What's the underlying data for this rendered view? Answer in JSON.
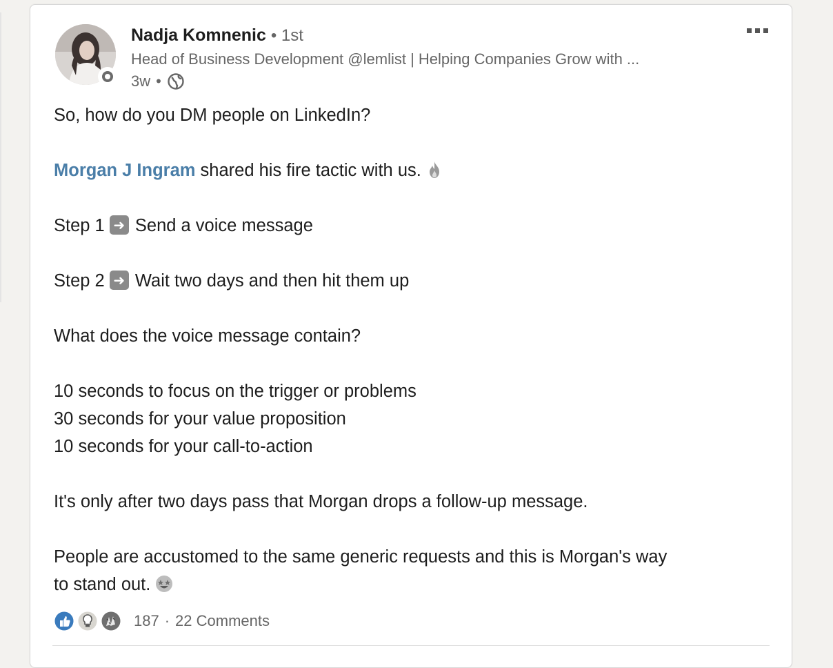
{
  "post": {
    "author": {
      "name": "Nadja Komnenic",
      "degree": "• 1st",
      "headline": "Head of Business Development @lemlist | Helping Companies Grow with ...",
      "time": "3w",
      "meta_sep": "•",
      "visibility_icon": "globe-icon"
    },
    "more_icon": "more-horizontal-icon",
    "body": {
      "line1": "So, how do you DM people on LinkedIn?",
      "mention": "Morgan J Ingram",
      "line2_rest": " shared his fire tactic with us. ",
      "step1_prefix": "Step 1 ",
      "step1_text": " Send a voice message",
      "step2_prefix": "Step 2 ",
      "step2_text": " Wait two days and then hit them up",
      "question": "What does the voice message contain?",
      "item1": "10 seconds to focus on the trigger or problems",
      "item2": "30 seconds for your value proposition",
      "item3": "10 seconds for your call-to-action",
      "followup": "It's only after two days pass that Morgan drops a follow-up message.",
      "closing_1": "People are accustomed to the same generic requests and this is Morgan's way",
      "closing_2": "to stand out. "
    },
    "social": {
      "reaction_icons": [
        "like-icon",
        "insightful-icon",
        "celebrate-icon"
      ],
      "reaction_count": "187",
      "separator": "·",
      "comments": "22 Comments"
    }
  },
  "colors": {
    "mention": "#4a7ea8",
    "secondary_text": "#666666",
    "like": "#3a7bbd"
  }
}
